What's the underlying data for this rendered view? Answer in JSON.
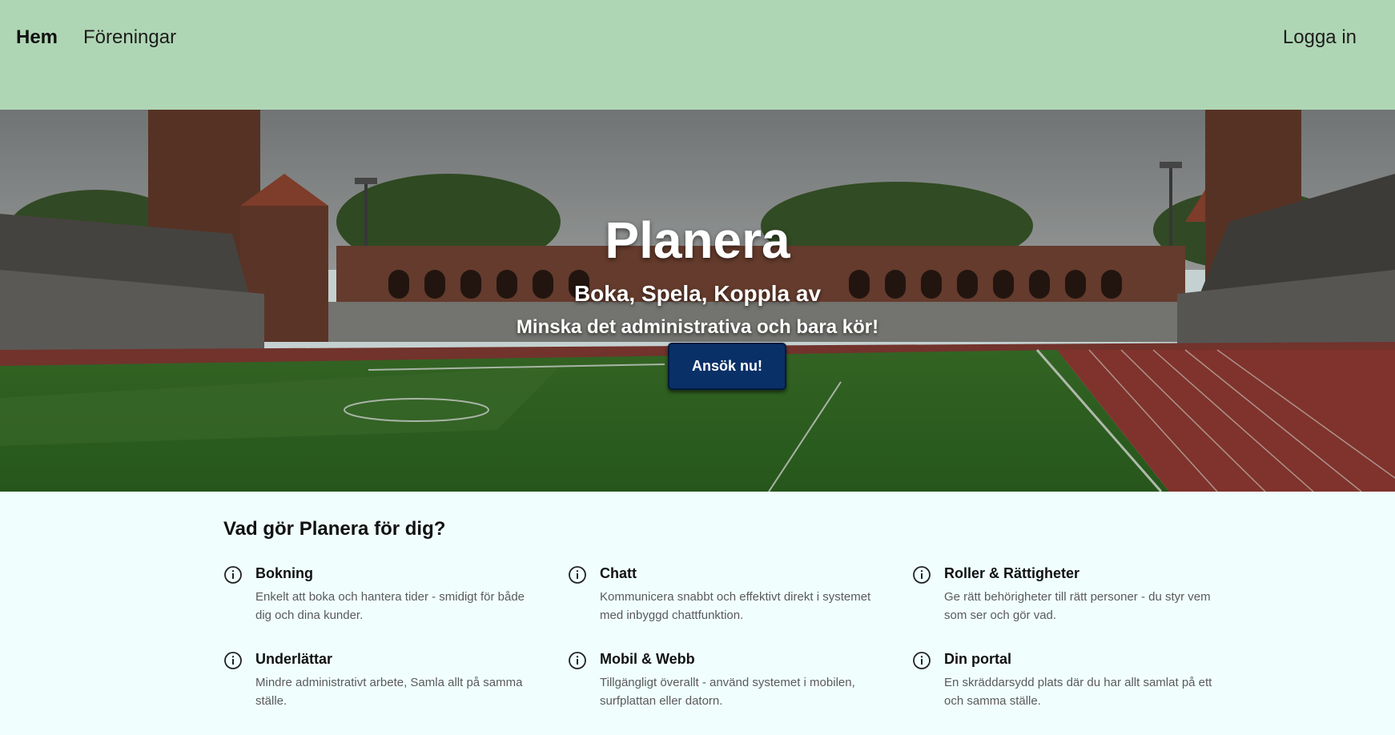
{
  "nav": {
    "home": "Hem",
    "clubs": "Föreningar",
    "login": "Logga in"
  },
  "hero": {
    "title": "Planera",
    "subtitle": "Boka, Spela, Koppla av",
    "tagline": "Minska det administrativa och bara kör!",
    "cta": "Ansök nu!",
    "background": "stadium-photo"
  },
  "features": {
    "heading": "Vad gör Planera för dig?",
    "icon": "info-circle-icon",
    "items": [
      {
        "title": "Bokning",
        "description": "Enkelt att boka och hantera tider - smidigt för både dig och dina kunder."
      },
      {
        "title": "Chatt",
        "description": "Kommunicera snabbt och effektivt direkt i systemet med inbyggd chattfunktion."
      },
      {
        "title": "Roller & Rättigheter",
        "description": "Ge rätt behörigheter till rätt personer - du styr vem som ser och gör vad."
      },
      {
        "title": "Underlättar",
        "description": "Mindre administrativt arbete, Samla allt på samma ställe."
      },
      {
        "title": "Mobil & Webb",
        "description": "Tillgängligt överallt - använd systemet i mobilen, surfplattan eller datorn."
      },
      {
        "title": "Din portal",
        "description": "En skräddarsydd plats där du har allt samlat på ett och samma ställe."
      }
    ]
  },
  "colors": {
    "nav_bg": "#afd6b4",
    "page_bg": "#f0fffe",
    "cta_bg": "#0a3068"
  }
}
